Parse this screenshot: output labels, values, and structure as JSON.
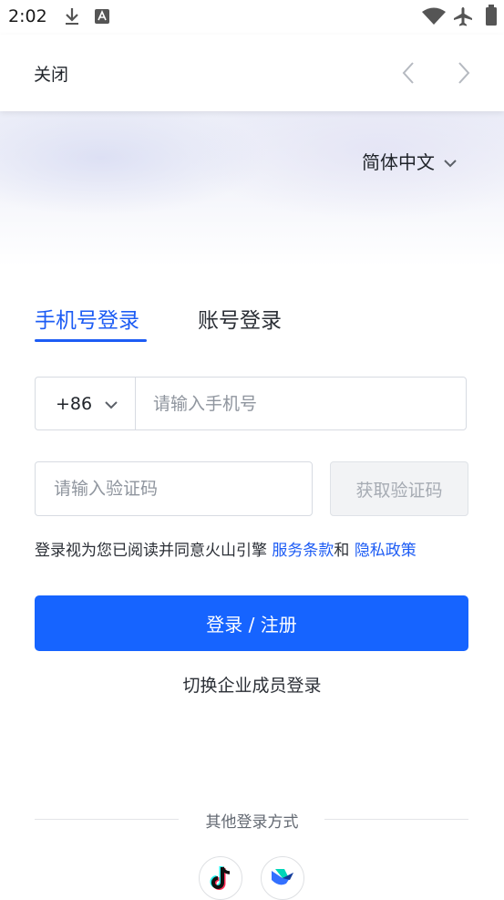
{
  "status_bar": {
    "time": "2:02"
  },
  "topbar": {
    "close_label": "关闭"
  },
  "language": {
    "selected": "简体中文"
  },
  "tabs": [
    {
      "label": "手机号登录",
      "active": true
    },
    {
      "label": "账号登录",
      "active": false
    }
  ],
  "phone": {
    "country_code": "+86",
    "placeholder": "请输入手机号"
  },
  "verification": {
    "placeholder": "请输入验证码",
    "get_code_label": "获取验证码"
  },
  "agreement": {
    "prefix": "登录视为您已阅读并同意火山引擎 ",
    "terms_link": "服务条款",
    "connector": "和 ",
    "privacy_link": "隐私政策"
  },
  "login_button": "登录 / 注册",
  "switch_enterprise": "切换企业成员登录",
  "other_login": {
    "label": "其他登录方式",
    "providers": [
      "douyin-icon",
      "feishu-icon"
    ]
  },
  "colors": {
    "primary": "#1664ff",
    "link": "#1d5cf4"
  }
}
